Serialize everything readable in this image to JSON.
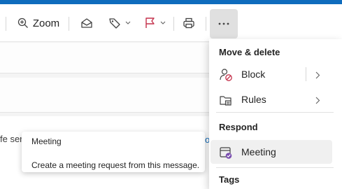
{
  "toolbar": {
    "zoom_label": "Zoom",
    "icons": [
      "zoom-icon",
      "envelope-open-icon",
      "tag-icon",
      "flag-icon",
      "print-icon",
      "more-icon"
    ],
    "flag_color": "#c4314b"
  },
  "message": {
    "body_text": "fe ser",
    "link_text": "o"
  },
  "tooltip": {
    "title": "Meeting",
    "description": "Create a meeting request from this message."
  },
  "menu": {
    "move_delete_header": "Move & delete",
    "block_label": "Block",
    "rules_label": "Rules",
    "respond_header": "Respond",
    "meeting_label": "Meeting",
    "tags_header": "Tags"
  },
  "colors": {
    "accent": "#0f6cbd",
    "block_icon": "#c4314b",
    "meeting_icon": "#7b4fb0"
  }
}
